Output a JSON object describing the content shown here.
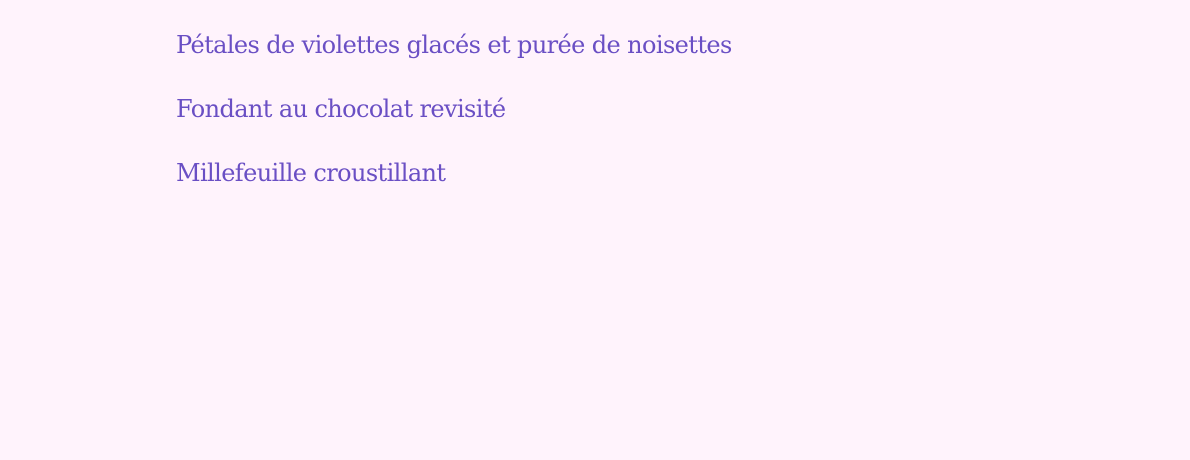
{
  "menu": {
    "items": [
      {
        "label": "Pétales de violettes glacés et purée de noisettes"
      },
      {
        "label": "Fondant au chocolat revisité"
      },
      {
        "label": "Millefeuille croustillant"
      }
    ]
  },
  "colors": {
    "background": "#fff3fc",
    "text": "#6a4fc4"
  }
}
